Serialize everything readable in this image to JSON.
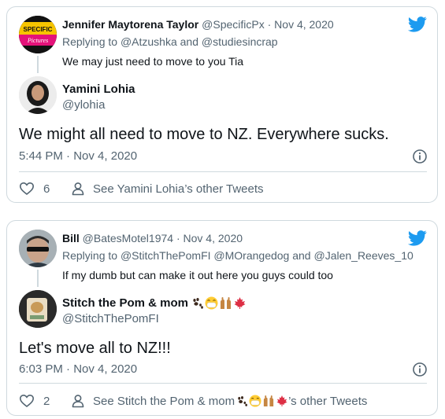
{
  "tweet1": {
    "context": {
      "name": "Jennifer Maytorena Taylor",
      "handle": "@SpecificPx",
      "date": "Nov 4, 2020",
      "replying_prefix": "Replying to",
      "reply_to_1": "@Atzushka",
      "reply_joiner": "and",
      "reply_to_2": "@studiesincrap",
      "text": "We may just need to move to you Tia",
      "avatar_text_top": "SPECIFIC",
      "avatar_text_bottom": "Pictures"
    },
    "main": {
      "name": "Yamini Lohia",
      "handle": "@ylohia",
      "text": "We might all need to move to NZ. Everywhere sucks.",
      "time": "5:44 PM",
      "date": "Nov 4, 2020",
      "like_count": "6",
      "profile_link": "See Yamini Lohia’s other Tweets"
    }
  },
  "tweet2": {
    "context": {
      "name": "Bill",
      "handle": "@BatesMotel1974",
      "date": "Nov 4, 2020",
      "replying_prefix": "Replying to",
      "reply_to_1": "@StitchThePomFI",
      "reply_to_2": "@MOrangedog",
      "reply_joiner": "and",
      "reply_to_3": "@Jalen_Reeves_10",
      "text": "If my dumb but can make it out here you guys could too"
    },
    "main": {
      "name": "Stitch the Pom & mom",
      "handle": "@StitchThePomFI",
      "text": "Let's move all to NZ!!!",
      "time": "6:03 PM",
      "date": "Nov 4, 2020",
      "like_count": "2",
      "profile_link_prefix": "See Stitch the Pom & mom",
      "profile_link_suffix": "’s other Tweets"
    }
  },
  "separator": "·",
  "colors": {
    "twitter_blue": "#1d9bf0",
    "text_primary": "#0f1419",
    "text_secondary": "#536471",
    "border": "#cfd9de"
  },
  "icons": [
    "twitter-logo-icon",
    "info-icon",
    "heart-icon",
    "person-icon",
    "paw-prints-icon",
    "mask-face-icon",
    "raised-hands-icon",
    "maple-leaf-icon"
  ]
}
